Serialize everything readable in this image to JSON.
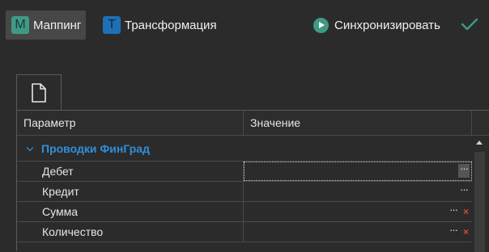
{
  "toolbar": {
    "mapping": {
      "letter": "M",
      "label": "Маппинг"
    },
    "transform": {
      "letter": "T",
      "label": "Трансформация"
    },
    "sync_label": "Синхронизировать"
  },
  "grid": {
    "headers": {
      "param": "Параметр",
      "value": "Значение"
    },
    "group": "Проводки ФинГрад",
    "rows": [
      {
        "name": "Дебет",
        "value": ""
      },
      {
        "name": "Кредит",
        "value": ""
      },
      {
        "name": "Сумма",
        "value": ""
      },
      {
        "name": "Количество",
        "value": ""
      }
    ],
    "ellipsis": "···",
    "clear": "×"
  },
  "colors": {
    "accent_teal": "#3f9a85",
    "accent_blue": "#1f6fb4",
    "group_text": "#2f8fd8",
    "clear_red": "#e0452c"
  }
}
